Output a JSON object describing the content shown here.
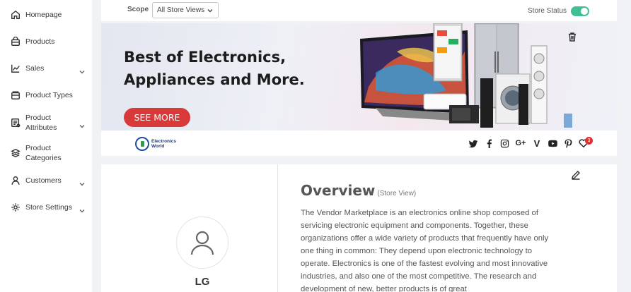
{
  "sidebar": {
    "items": [
      {
        "label": "Homepage",
        "icon": "home-icon"
      },
      {
        "label": "Products",
        "icon": "bag-icon"
      },
      {
        "label": "Sales",
        "icon": "chart-icon"
      },
      {
        "label": "Product Types",
        "icon": "box-icon"
      },
      {
        "label": "Product Attributes",
        "icon": "attributes-icon"
      },
      {
        "label": "Product Categories",
        "icon": "layers-icon"
      },
      {
        "label": "Customers",
        "icon": "user-icon"
      },
      {
        "label": "Store Settings",
        "icon": "settings-icon"
      }
    ]
  },
  "topbar": {
    "scope_label": "Scope",
    "scope_value": "All Store Views",
    "status_label": "Store Status",
    "status_on": true
  },
  "banner": {
    "headline_line1": "Best of Electronics,",
    "headline_line2": "Appliances and More.",
    "cta": "SEE MORE"
  },
  "brand": {
    "logo_line1": "Electronics",
    "logo_line2": "World"
  },
  "socials": [
    "twitter-icon",
    "facebook-icon",
    "instagram-icon",
    "google-plus-icon",
    "vimeo-icon",
    "youtube-icon",
    "pinterest-icon"
  ],
  "wishlist": {
    "count": "3"
  },
  "store": {
    "name": "LG",
    "overview_title": "Overview",
    "overview_scope": "(Store View)",
    "overview_text": "The Vendor Marketplace is an electronics online shop composed of servicing  electronic equipment and components. Together, these organizations offer a wide variety of products that frequently have only one thing in common: They depend upon electronic technology to operate. Electronics is one of the fastest evolving and most innovative industries, and also one of the most competitive. The research and development of new, better products is of great"
  },
  "colors": {
    "accent_green": "#3fbf93",
    "cta_red": "#d83a3a",
    "badge_red": "#e03131"
  }
}
